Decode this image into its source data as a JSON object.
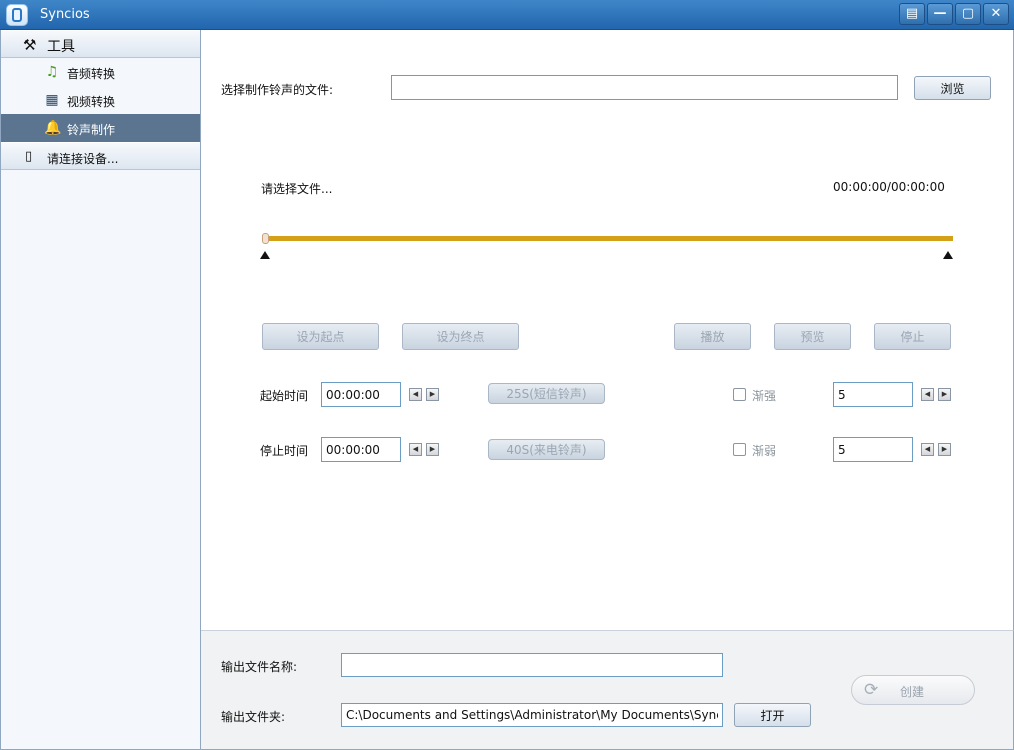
{
  "window": {
    "title": "Syncios",
    "controls": [
      "▤",
      "—",
      "▢",
      "✕"
    ]
  },
  "sidebar": {
    "tools_group": {
      "label": "工具",
      "icon": "tools-icon"
    },
    "items": [
      {
        "label": "音频转换",
        "icon": "music-note-icon"
      },
      {
        "label": "视频转换",
        "icon": "film-icon"
      },
      {
        "label": "铃声制作",
        "icon": "bell-icon",
        "active": true
      }
    ],
    "device_group": {
      "label": "请连接设备...",
      "icon": "phone-icon"
    }
  },
  "main": {
    "select_file_label": "选择制作铃声的文件:",
    "select_file_value": "",
    "browse_label": "浏览",
    "status_text": "请选择文件...",
    "time_display": "00:00:00/00:00:00",
    "set_start_label": "设为起点",
    "set_end_label": "设为终点",
    "play_label": "播放",
    "preview_label": "预览",
    "stop_label": "停止",
    "start_time_label": "起始时间",
    "start_time_value": "00:00:00",
    "stop_time_label": "停止时间",
    "stop_time_value": "00:00:00",
    "preset_sms_label": "25S(短信铃声)",
    "preset_call_label": "40S(来电铃声)",
    "fade_in_label": "渐强",
    "fade_in_value": "5",
    "fade_out_label": "渐弱",
    "fade_out_value": "5"
  },
  "footer": {
    "output_name_label": "输出文件名称:",
    "output_name_value": "",
    "output_folder_label": "输出文件夹:",
    "output_folder_value": "C:\\Documents and Settings\\Administrator\\My Documents\\Syncios\\Co",
    "open_label": "打开",
    "create_label": "创建"
  },
  "colors": {
    "titlebar": "#2a6fb4",
    "active_item": "#5b7591",
    "timeline": "#d4a017"
  }
}
